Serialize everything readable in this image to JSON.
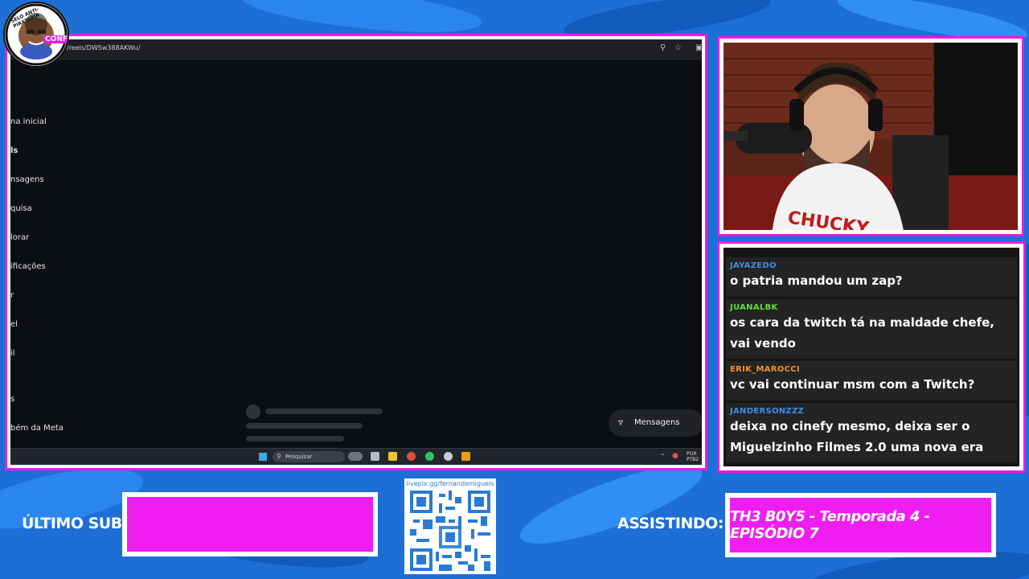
{
  "seal": {
    "text": "SELO ANTI-PIRATARIA",
    "badge": "CONFIA"
  },
  "browser": {
    "url": "/reels/DWSw388AKWu/",
    "nav_items": [
      "na inicial",
      "ls",
      "nsagens",
      "quisa",
      "lorar",
      "ificações",
      "r",
      "el",
      "il",
      "s",
      "bém da Meta"
    ],
    "messages_button": "Mensagens"
  },
  "taskbar": {
    "search_placeholder": "Pesquisar",
    "lang_line1": "POR",
    "lang_line2": "PTB2"
  },
  "chat": {
    "messages": [
      {
        "user": "JAYAZEDO",
        "color": "#3b8fe8",
        "text": "o patria mandou um zap?"
      },
      {
        "user": "JUANALBK",
        "color": "#5fe02f",
        "text": "os cara da twitch tá na maldade chefe, vai vendo"
      },
      {
        "user": "ERIK_MAROCCI",
        "color": "#f2921d",
        "text": "vc vai continuar msm com a Twitch?"
      },
      {
        "user": "JANDERSONZZZ",
        "color": "#3b8fe8",
        "text": "deixa no cinefy mesmo, deixa ser o Miguelzinho Filmes 2.0 uma nova era"
      }
    ]
  },
  "bottom": {
    "last_sub_label": "ÚLTIMO SUB:",
    "last_sub_value": "",
    "qr_url": "livepix.gg/fernandemiguels",
    "watching_label": "ASSISTINDO:",
    "watching_value": "TH3 B0Y5 - Temporada 4 - EPISÓDIO 7"
  },
  "colors": {
    "accent": "#e71ce6",
    "background": "#1d6fd6"
  }
}
